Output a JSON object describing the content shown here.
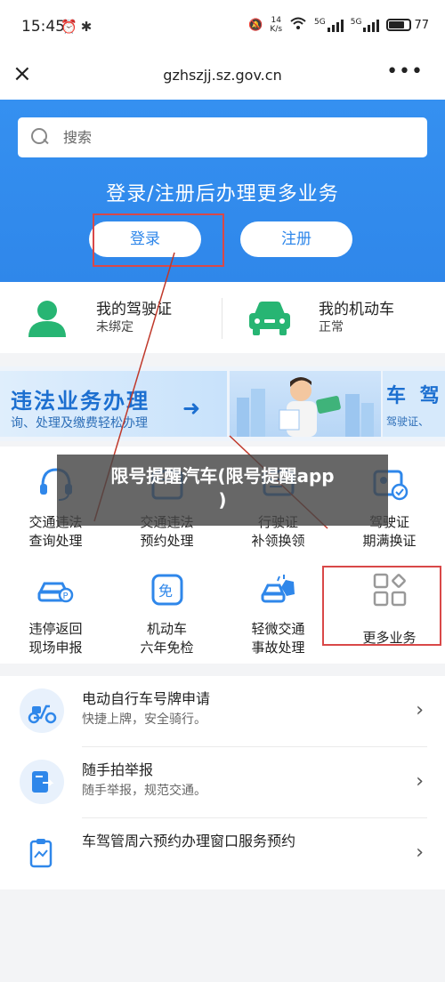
{
  "status_bar": {
    "time": "15:45",
    "net_speed_value": "14",
    "net_speed_unit": "K/s",
    "signal_label_1": "5G",
    "signal_label_2": "5G",
    "battery": "77",
    "battery_level": 0.77
  },
  "nav": {
    "close_glyph": "×",
    "url": "gzhszjj.sz.gov.cn",
    "more_glyph": "•••"
  },
  "hero": {
    "search_placeholder": "搜索",
    "tagline": "登录/注册后办理更多业务",
    "login_label": "登录",
    "register_label": "注册"
  },
  "cards": [
    {
      "title": "我的驾驶证",
      "subtitle": "未绑定",
      "icon": "id-card-icon"
    },
    {
      "title": "我的机动车",
      "subtitle": "正常",
      "icon": "car-icon"
    }
  ],
  "banner": {
    "title": "违法业务办理",
    "subtitle": "询、处理及缴费轻松办理",
    "right_title": "车 驾",
    "right_subtitle": "驾驶证、"
  },
  "services": [
    {
      "line1": "交通违法",
      "line2": "查询处理",
      "icon": "headset-icon"
    },
    {
      "line1": "交通违法",
      "line2": "预约处理",
      "icon": "calendar-icon"
    },
    {
      "line1": "行驶证",
      "line2": "补领换领",
      "icon": "license-icon"
    },
    {
      "line1": "驾驶证",
      "line2": "期满换证",
      "icon": "renew-card-icon"
    },
    {
      "line1": "违停返回",
      "line2": "现场申报",
      "icon": "parking-car-icon"
    },
    {
      "line1": "机动车",
      "line2": "六年免检",
      "icon": "exempt-icon"
    },
    {
      "line1": "轻微交通",
      "line2": "事故处理",
      "icon": "accident-icon"
    },
    {
      "line1": "更多业务",
      "line2": "",
      "icon": "grid-icon"
    }
  ],
  "caption": {
    "line1": "限号提醒汽车(限号提醒app",
    "line2": ")"
  },
  "list": [
    {
      "title": "电动自行车号牌申请",
      "subtitle": "快捷上牌，安全骑行。",
      "icon": "scooter-icon"
    },
    {
      "title": "随手拍举报",
      "subtitle": "随手举报，规范交通。",
      "icon": "report-icon"
    },
    {
      "title": "车驾管周六预约办理窗口服务预约",
      "subtitle": "",
      "icon": "clipboard-icon"
    }
  ],
  "colors": {
    "brand_blue": "#2f87ea",
    "highlight_red": "#d94848",
    "icon_green": "#27b573",
    "icon_blue": "#2f87ea"
  }
}
